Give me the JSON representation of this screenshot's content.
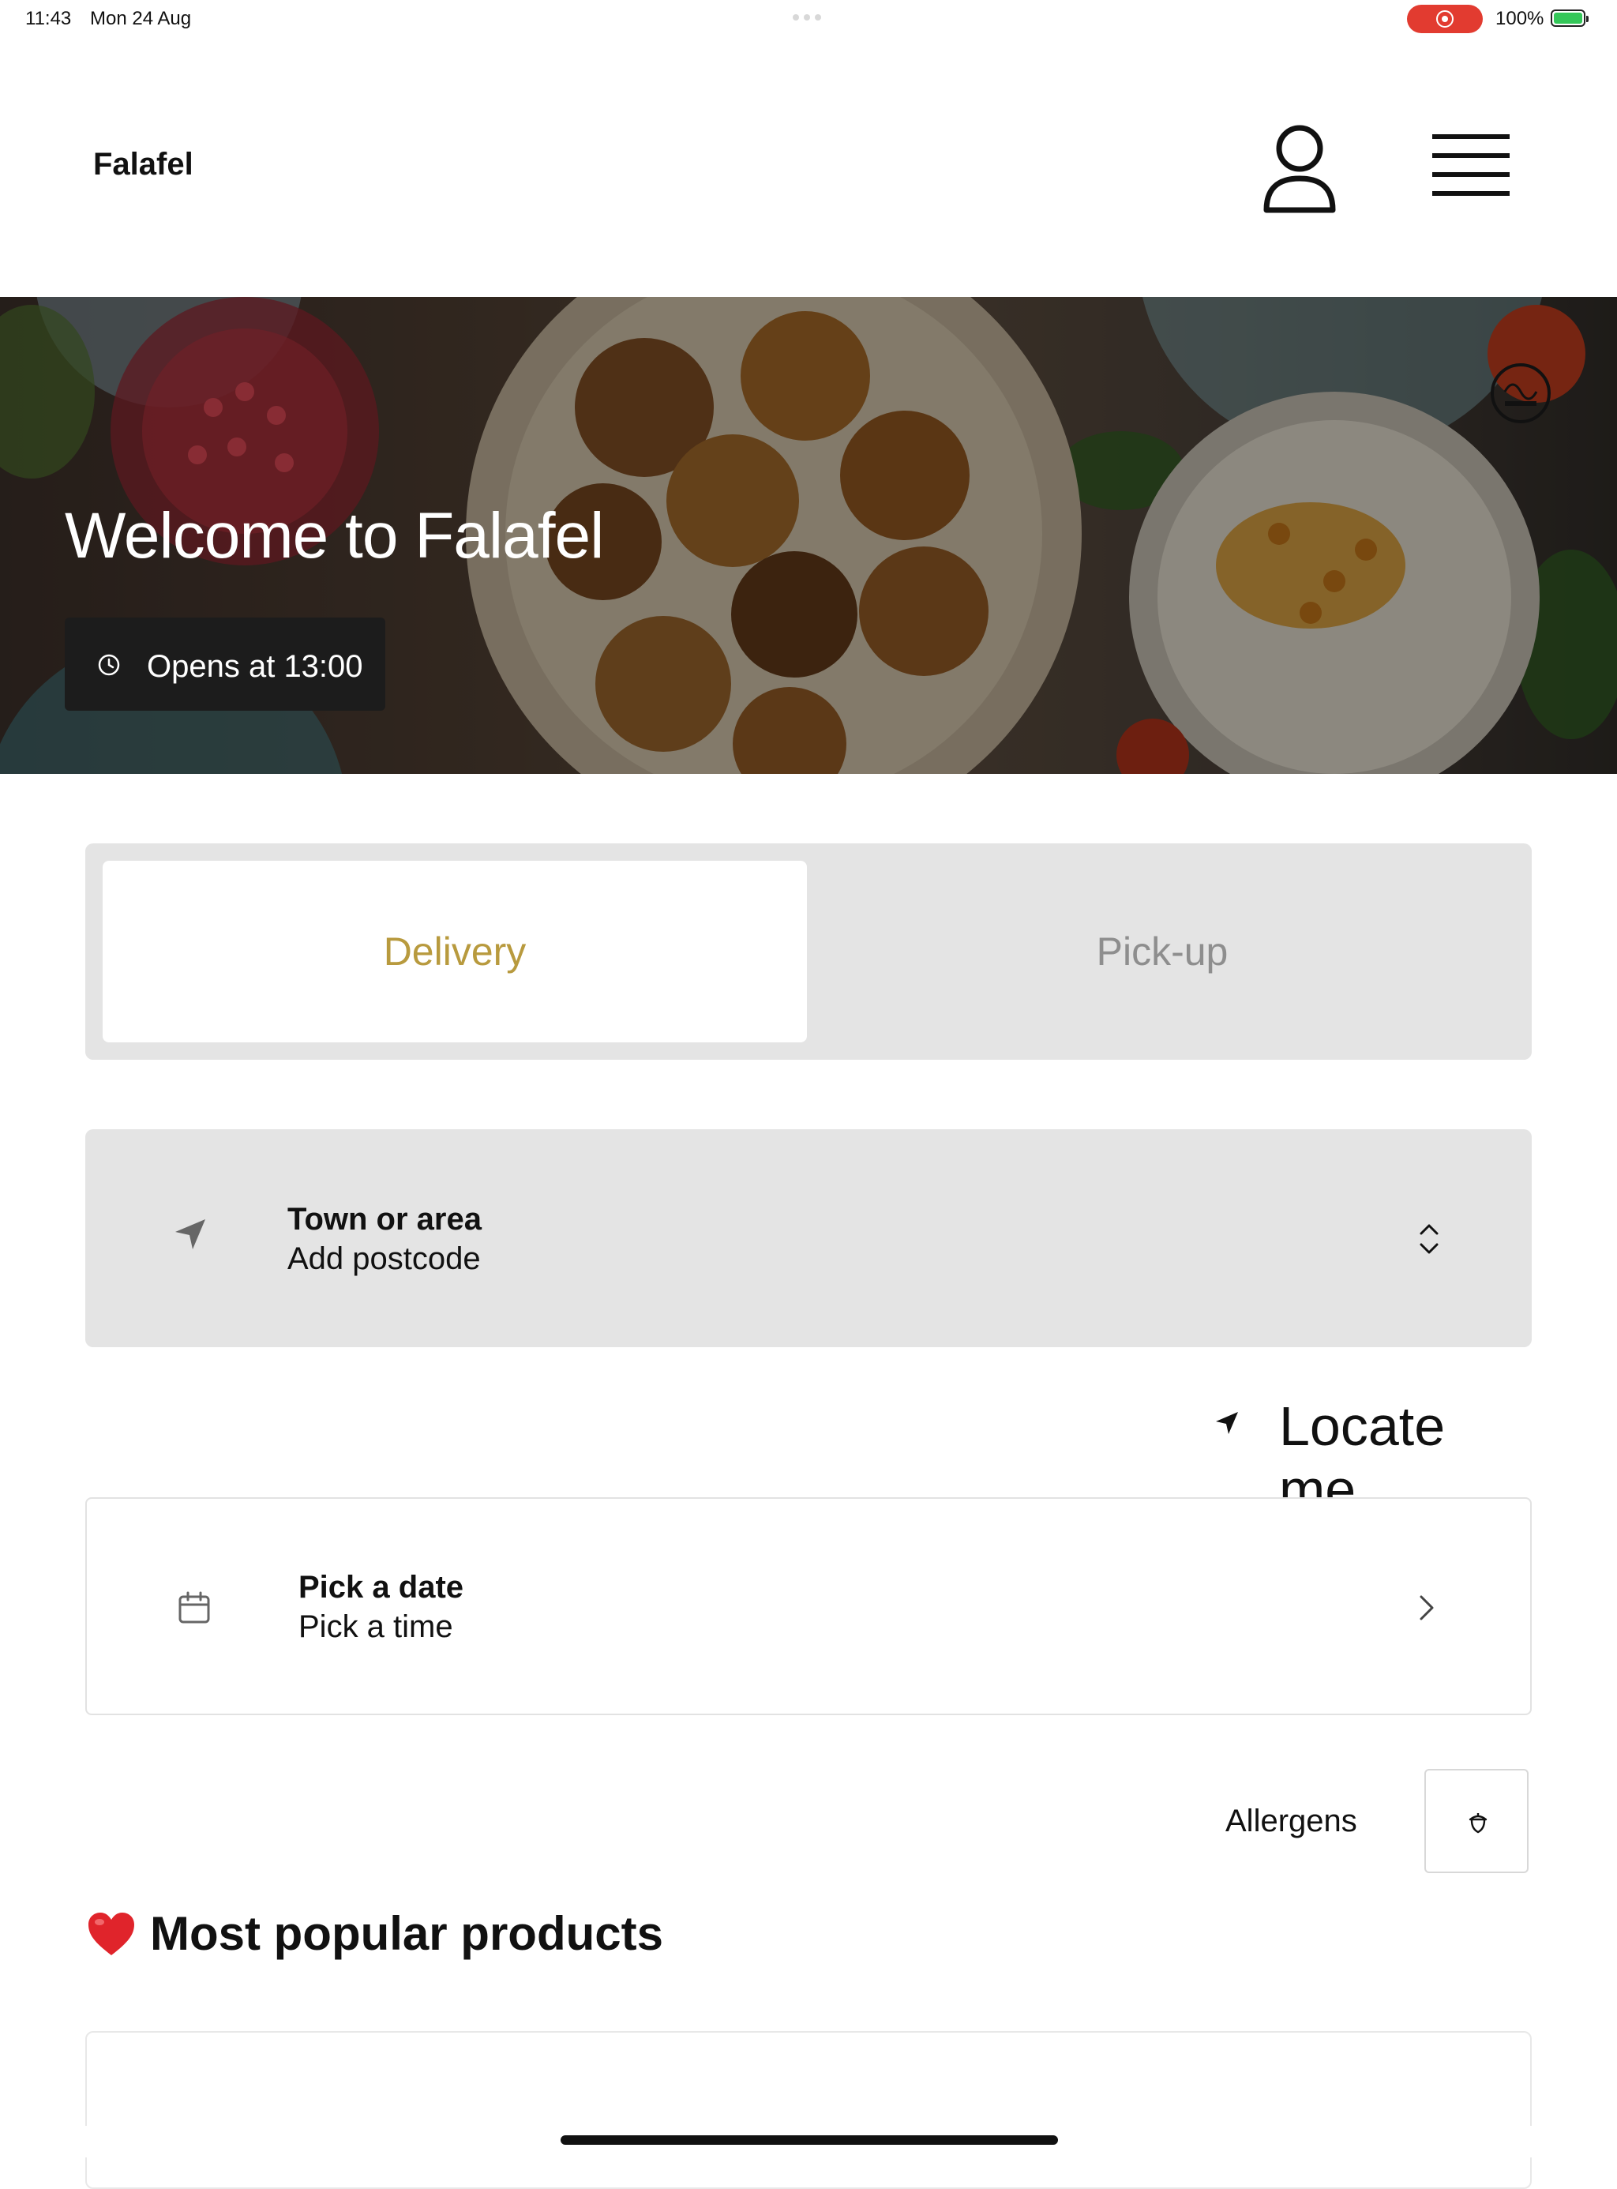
{
  "status_bar": {
    "time": "11:43",
    "date": "Mon 24 Aug",
    "battery": "100%"
  },
  "header": {
    "brand": "Falafel",
    "account_icon": "person-icon",
    "menu_icon": "hamburger-menu-icon"
  },
  "hero": {
    "title": "Welcome to Falafel",
    "opens_text": "Opens at 13:00",
    "badge_icon": "halal-logo"
  },
  "order_mode": {
    "tabs": [
      {
        "label": "Delivery",
        "active": true
      },
      {
        "label": "Pick-up",
        "active": false
      }
    ],
    "active_color": "#b89a3e"
  },
  "location": {
    "title": "Town or area",
    "subtitle": "Add postcode",
    "icon": "location-arrow-icon",
    "chevron_icon": "chevron-up-down-icon"
  },
  "locate_me": {
    "label": "Locate me",
    "icon": "location-arrow-icon"
  },
  "schedule": {
    "title": "Pick a date",
    "subtitle": "Pick a time",
    "icon": "calendar-icon",
    "chevron_icon": "chevron-right-icon"
  },
  "allergens": {
    "label": "Allergens",
    "icon": "acorn-icon"
  },
  "popular": {
    "heading": "Most popular products",
    "emoji_icon": "red-heart-icon"
  }
}
